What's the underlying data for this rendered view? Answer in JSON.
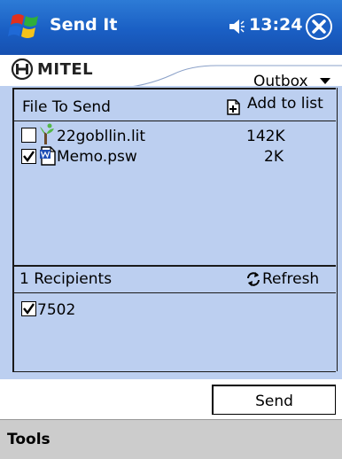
{
  "titlebar": {
    "app_title": "Send It",
    "clock": "13:24"
  },
  "header": {
    "logo": "MITEL",
    "folder": "Outbox"
  },
  "files": {
    "column_label": "File To Send",
    "add_label": "Add to list",
    "items": [
      {
        "name": "22gobllin.lit",
        "size": "142K",
        "checked": false,
        "icon": "lit-file-icon"
      },
      {
        "name": "Memo.psw",
        "size": "2K",
        "checked": true,
        "icon": "word-doc-icon"
      }
    ]
  },
  "recipients": {
    "count_label": "1 Recipients",
    "refresh_label": "Refresh",
    "items": [
      {
        "name": "7502",
        "checked": true
      }
    ]
  },
  "actions": {
    "send_label": "Send"
  },
  "menubar": {
    "tools_label": "Tools"
  },
  "colors": {
    "titlebar": "#1a5fc4",
    "content_bg": "#bccff0",
    "menubar_bg": "#cccccc"
  }
}
